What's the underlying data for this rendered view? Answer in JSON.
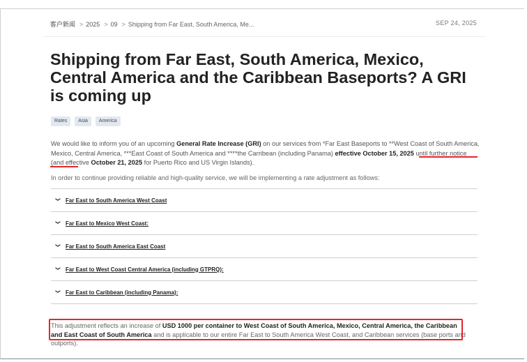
{
  "breadcrumb": {
    "items": [
      "客户新闻",
      "2025",
      "09",
      "Shipping from Far East, South America, Me..."
    ],
    "separator": ">"
  },
  "date": "SEP 24, 2025",
  "title": "Shipping from Far East, South America, Mexico, Central America and the Caribbean Baseports? A GRI is coming up",
  "tags": [
    "Rates",
    "Asia",
    "America"
  ],
  "intro": {
    "t1": "We would like to inform you of an upcoming ",
    "b1": "General Rate Increase (GRI)",
    "t2": " on our services from *Far East Baseports to **West Coast of South America, Mexico, Central America, ***East Coast of South America and ****the Carribean (including Panama) ",
    "b2": "effective October 15, 2025",
    "t3": " until further notice (and effective ",
    "b3": "October 21, 2025",
    "t4": " for Puerto Rico and US Virgin Islands)."
  },
  "lead": "In order to continue providing reliable and high-quality service, we will be implementing a rate adjustment as follows:",
  "accordion": [
    "Far East to South America West Coast",
    "Far East to Mexico West Coast:",
    "Far East to South America East Coast",
    "Far East to West Coast Central America (including GTPRQ):",
    "Far East to Caribbean (including Panama):"
  ],
  "summary": {
    "t1": "This adjustment reflects an increase of ",
    "b1": "USD 1000 per container to West Coast of South America, Mexico, Central America, the Caribbean and East Coast of South America",
    "t2": " and is applicable to our entire Far East to South America West Coast, and Caribbean services (base ports and outports)."
  },
  "colors": {
    "highlight": "#e3262d",
    "tag_bg": "#e3e8ef"
  }
}
